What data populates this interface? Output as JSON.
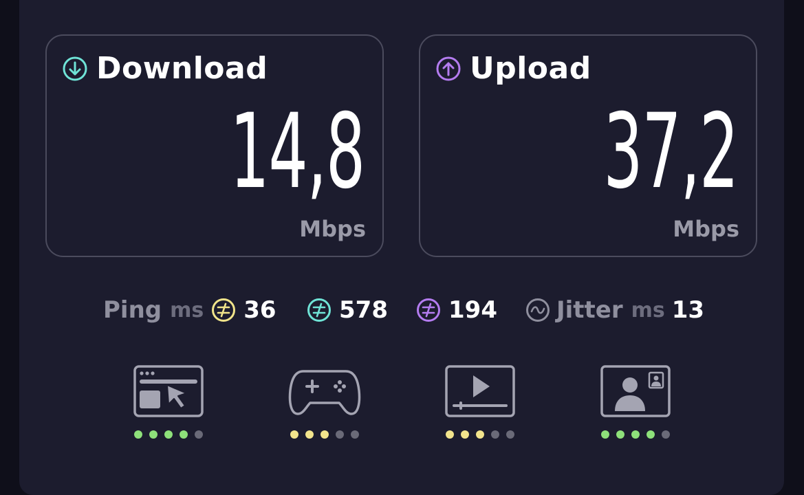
{
  "download": {
    "title": "Download",
    "value": "14,8",
    "unit": "Mbps",
    "icon": "arrow-down-circle-icon",
    "color": "#6fe3d6"
  },
  "upload": {
    "title": "Upload",
    "value": "37,2",
    "unit": "Mbps",
    "icon": "arrow-up-circle-icon",
    "color": "#b47cf0"
  },
  "ping": {
    "label": "Ping",
    "unit": "ms",
    "idle": {
      "value": "36",
      "color": "#f1e48a"
    },
    "download": {
      "value": "578",
      "color": "#6fe3d6"
    },
    "upload": {
      "value": "194",
      "color": "#b47cf0"
    }
  },
  "jitter": {
    "label": "Jitter",
    "unit": "ms",
    "value": "13"
  },
  "use_cases": [
    {
      "name": "web-browsing",
      "icon": "browser-cursor-icon",
      "rating": 4,
      "max": 5,
      "color": "#8ee07a"
    },
    {
      "name": "gaming",
      "icon": "gamepad-icon",
      "rating": 3,
      "max": 5,
      "color": "#f2e48c"
    },
    {
      "name": "video-streaming",
      "icon": "video-player-icon",
      "rating": 3,
      "max": 5,
      "color": "#f2e48c"
    },
    {
      "name": "video-call",
      "icon": "video-call-icon",
      "rating": 4,
      "max": 5,
      "color": "#8ee07a"
    }
  ]
}
